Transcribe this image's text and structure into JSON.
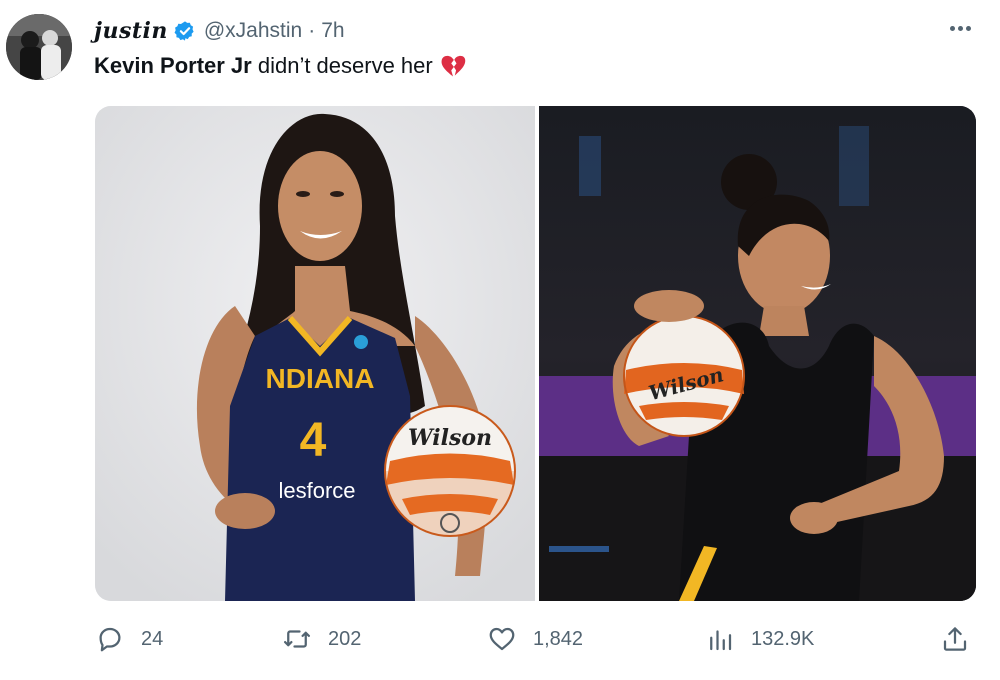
{
  "tweet": {
    "display_name": "justin",
    "verified_icon": "verified-badge-icon",
    "handle": "@xJahstin",
    "separator": "·",
    "time": "7h",
    "text_bold": "Kevin Porter Jr",
    "text_rest": " didn’t deserve her",
    "emoji": "broken-heart-icon"
  },
  "media": {
    "left": {
      "jersey_text": "NDIANA",
      "jersey_number": "4",
      "sponsor": "lesforce",
      "ball_brand": "Wilson"
    },
    "right": {
      "ball_brand": "Wilson"
    }
  },
  "actions": {
    "reply_count": "24",
    "retweet_count": "202",
    "like_count": "1,842",
    "view_count": "132.9K"
  },
  "colors": {
    "text": "#0f1419",
    "muted": "#536471",
    "verified": "#1d9bf0",
    "heart": "#e0245e"
  }
}
